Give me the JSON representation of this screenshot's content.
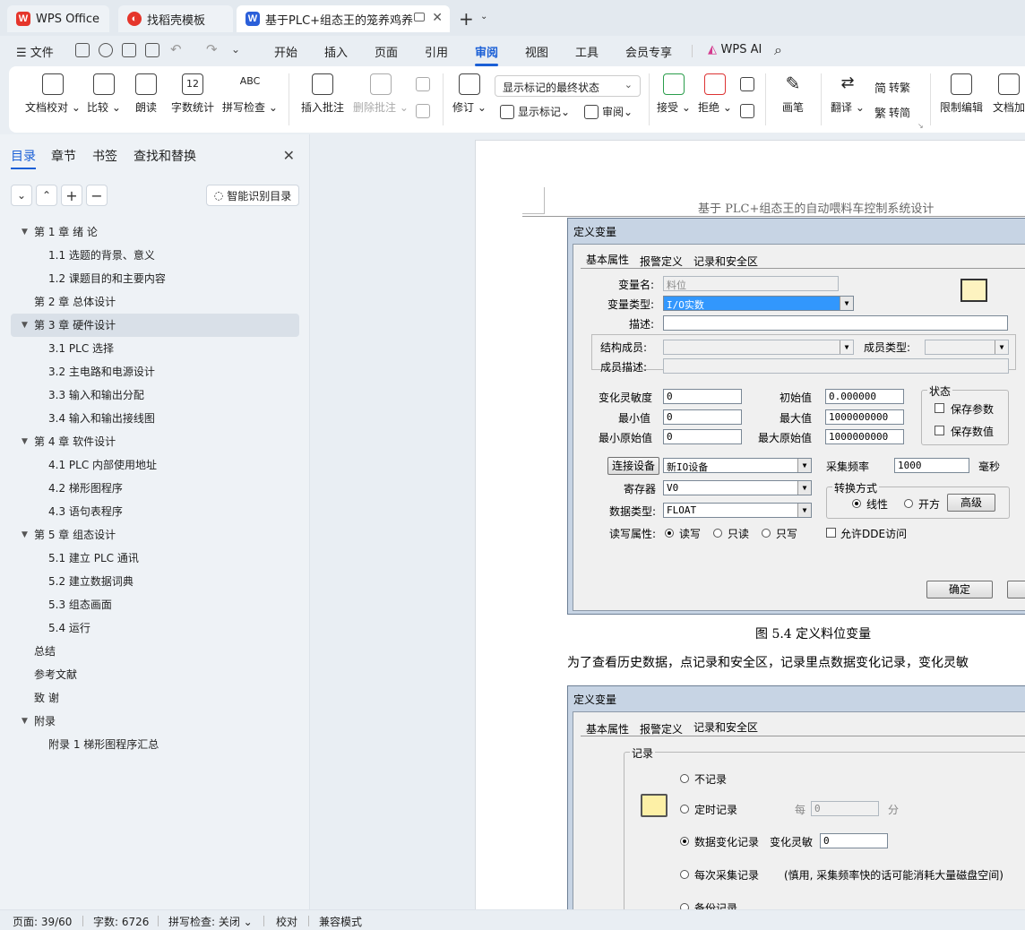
{
  "tabs": [
    {
      "label": "WPS Office",
      "logo": "W"
    },
    {
      "label": "找稻壳模板",
      "logo": "◐"
    },
    {
      "label": "基于PLC+组态王的笼养鸡养殖",
      "logo": "W"
    }
  ],
  "new_tab": "+",
  "menu": {
    "file": "文件",
    "items": [
      "开始",
      "插入",
      "页面",
      "引用",
      "审阅",
      "视图",
      "工具",
      "会员专享"
    ],
    "active": "审阅",
    "wps_ai": "WPS AI"
  },
  "ribbon": {
    "doc_check": "文档校对",
    "compare": "比较",
    "read_aloud": "朗读",
    "word_count": "字数统计",
    "spell_check": "拼写检查",
    "insert_comment": "插入批注",
    "delete_comment": "删除批注",
    "revise": "修订",
    "show_markup_state": "显示标记的最终状态",
    "show_markup": "显示标记",
    "review": "审阅",
    "accept": "接受",
    "reject": "拒绝",
    "pen": "画笔",
    "translate": "翻译",
    "to_traditional": "转繁",
    "to_simplified": "转简",
    "restrict_edit": "限制编辑",
    "doc_encrypt": "文档加",
    "word_count_icon_text": "12",
    "spell_icon_text": "ABC"
  },
  "sidebar": {
    "tabs": [
      "目录",
      "章节",
      "书签",
      "查找和替换"
    ],
    "active_tab": "目录",
    "smart_button": "智能识别目录",
    "toc": [
      {
        "label": "第 1 章   绪  论",
        "level": 1,
        "expanded": true
      },
      {
        "label": "1.1 选题的背景、意义",
        "level": 2
      },
      {
        "label": "1.2 课题目的和主要内容",
        "level": 2
      },
      {
        "label": "第 2 章   总体设计",
        "level": 1
      },
      {
        "label": "第 3 章   硬件设计",
        "level": 1,
        "expanded": true,
        "selected": true
      },
      {
        "label": "3.1 PLC 选择",
        "level": 2
      },
      {
        "label": "3.2  主电路和电源设计",
        "level": 2
      },
      {
        "label": "3.3  输入和输出分配",
        "level": 2
      },
      {
        "label": "3.4  输入和输出接线图",
        "level": 2
      },
      {
        "label": "第 4 章   软件设计",
        "level": 1,
        "expanded": true
      },
      {
        "label": "4.1 PLC 内部使用地址",
        "level": 2
      },
      {
        "label": "4.2  梯形图程序",
        "level": 2
      },
      {
        "label": "4.3  语句表程序",
        "level": 2
      },
      {
        "label": "第 5 章   组态设计",
        "level": 1,
        "expanded": true
      },
      {
        "label": "5.1 建立 PLC 通讯",
        "level": 2
      },
      {
        "label": "5.2  建立数据词典",
        "level": 2
      },
      {
        "label": "5.3  组态画面",
        "level": 2
      },
      {
        "label": "5.4 运行",
        "level": 2
      },
      {
        "label": "总结",
        "level": 1
      },
      {
        "label": "参考文献",
        "level": 1
      },
      {
        "label": "致  谢",
        "level": 1
      },
      {
        "label": "附录",
        "level": 1,
        "expanded": true
      },
      {
        "label": "附录 1  梯形图程序汇总",
        "level": 2
      }
    ]
  },
  "document": {
    "header": "基于 PLC+组态王的自动喂料车控制系统设计",
    "dialog1": {
      "title": "定义变量",
      "tabs": [
        "基本属性",
        "报警定义",
        "记录和安全区"
      ],
      "var_name_label": "变量名:",
      "var_name": "料位",
      "var_type_label": "变量类型:",
      "var_type": "I/O实数",
      "desc_label": "描述:",
      "struct_member_label": "结构成员:",
      "member_type_label": "成员类型:",
      "member_desc_label": "成员描述:",
      "sensitivity_label": "变化灵敏度",
      "sensitivity": "0",
      "init_label": "初始值",
      "init": "0.000000",
      "min_label": "最小值",
      "min": "0",
      "max_label": "最大值",
      "max": "1000000000",
      "min_raw_label": "最小原始值",
      "min_raw": "0",
      "max_raw_label": "最大原始值",
      "max_raw": "1000000000",
      "state_group": "状态",
      "save_param": "保存参数",
      "save_value": "保存数值",
      "connect_device_btn": "连接设备",
      "device": "新IO设备",
      "sample_rate_label": "采集频率",
      "sample_rate": "1000",
      "ms": "毫秒",
      "register_label": "寄存器",
      "register": "V0",
      "conversion_group": "转换方式",
      "linear": "线性",
      "sqrt": "开方",
      "advanced_btn": "高级",
      "data_type_label": "数据类型:",
      "data_type": "FLOAT",
      "rw_label": "读写属性:",
      "rw": "读写",
      "ro": "只读",
      "wo": "只写",
      "allow_dde": "允许DDE访问",
      "ok_btn": "确定",
      "cancel_btn": "取"
    },
    "caption1": "图 5.4  定义料位变量",
    "paragraph": "为了查看历史数据，点记录和安全区，记录里点数据变化记录，变化灵敏",
    "dialog2": {
      "title": "定义变量",
      "tabs": [
        "基本属性",
        "报警定义",
        "记录和安全区"
      ],
      "record_group": "记录",
      "no_record": "不记录",
      "timed_record": "定时记录",
      "every": "每",
      "every_val": "0",
      "minutes": "分",
      "data_change_record": "数据变化记录",
      "change_sensitivity": "变化灵敏",
      "change_val": "0",
      "each_sample": "每次采集记录",
      "each_sample_note": "(慎用, 采集频率快的话可能消耗大量磁盘空间)",
      "backup_record": "备份记录"
    }
  },
  "status": {
    "page": "页面: 39/60",
    "words": "字数: 6726",
    "spell": "拼写检查: 关闭",
    "proof": "校对",
    "compat": "兼容模式"
  },
  "colors": {
    "accent": "#1a5fd6",
    "wps_red": "#e5352b",
    "doc_blue": "#2b5fd9",
    "selection": "#3297fd"
  }
}
